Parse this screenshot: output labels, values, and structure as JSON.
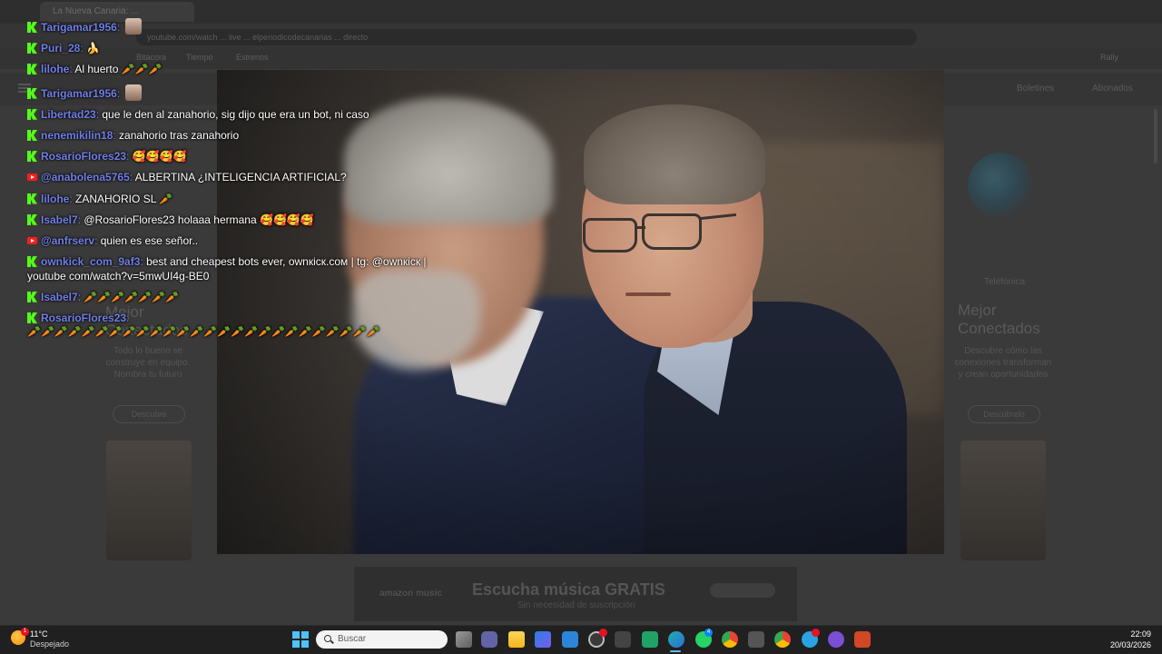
{
  "browser": {
    "tab_title": "La Nueva Canaria: ...",
    "address": "youtube.com/watch ... live ... elperiodicodecanarias ... directo",
    "toolbar_items": [
      "Bitacora",
      "Tiempo",
      "Estrenos",
      "Rally"
    ]
  },
  "site": {
    "links": [
      "Boletines",
      "Abonados"
    ],
    "left_promo": {
      "title": "Mejor Conectados",
      "text": "Todo lo bueno se construye en equipo. Nombra tu futuro",
      "button": "Descubre"
    },
    "right_promo": {
      "logo": "Telefónica",
      "title": "Mejor Conectados",
      "text": "Descubre cómo las conexiones transforman y crean oportunidades",
      "button": "Descúbrelo"
    },
    "ad": {
      "brand": "amazon music",
      "headline": "Escucha música GRATIS",
      "subline": "Sin necesidad de suscripción"
    }
  },
  "chat": {
    "messages": [
      {
        "platform": "kick",
        "user": "Tarigamar1956",
        "text": "",
        "emote": "avatar"
      },
      {
        "platform": "kick",
        "user": "Puri_28",
        "text": "",
        "emote": "🍌"
      },
      {
        "platform": "kick",
        "user": "lilohe",
        "text": "Al huerto 🥕🥕🥕",
        "emote": ""
      },
      {
        "platform": "kick",
        "user": "Tarigamar1956",
        "text": "",
        "emote": "avatar"
      },
      {
        "platform": "kick",
        "user": "Libertad23",
        "text": "que le den al zanahorio, sig dijo que era un bot, ni caso",
        "emote": ""
      },
      {
        "platform": "kick",
        "user": "nenemikilin18",
        "text": "zanahorio tras zanahorio",
        "emote": ""
      },
      {
        "platform": "kick",
        "user": "RosarioFlores23",
        "text": "",
        "emote": "🥰🥰🥰🥰"
      },
      {
        "platform": "youtube",
        "user": "@anabolena5765",
        "text": "ALBERTINA ¿INTELIGENCIA ARTIFICIAL?",
        "emote": ""
      },
      {
        "platform": "kick",
        "user": "lilohe",
        "text": "ZANAHORIO SL 🥕",
        "emote": ""
      },
      {
        "platform": "kick",
        "user": "Isabel7",
        "text": "@RosarioFlores23 holaaa hermana",
        "emote": "🥰🥰🥰🥰"
      },
      {
        "platform": "youtube",
        "user": "@anfrserv",
        "text": "quien es ese señor..",
        "emote": ""
      },
      {
        "platform": "kick",
        "user": "ownkick_com_9af3",
        "text": "best and cheapest bots ever, ownкicк.coм | tg: @ownкicк | youtube com/watch?v=5mwUI4g-BE0",
        "emote": ""
      },
      {
        "platform": "kick",
        "user": "Isabel7",
        "text": "",
        "emote": "🥕🥕🥕🥕🥕🥕🥕"
      },
      {
        "platform": "kick",
        "user": "RosarioFlores23",
        "text": "",
        "emote": "🥕🥕🥕🥕🥕🥕🥕🥕🥕🥕🥕🥕🥕🥕🥕🥕🥕🥕🥕🥕🥕🥕🥕🥕🥕🥕"
      }
    ]
  },
  "taskbar": {
    "weather_temp": "11°C",
    "weather_desc": "Despejado",
    "weather_badge": "1",
    "search_placeholder": "Buscar",
    "teams_badge": "",
    "whatsapp_badge": "4",
    "telegram_badge": "",
    "clock_time": "22:09",
    "clock_date": "20/03/2026"
  },
  "colors": {
    "kick_green": "#53fc18",
    "username_blue": "#6f7fe8",
    "youtube_red": "#ff1c1c",
    "taskbar_bg": "#202020"
  }
}
